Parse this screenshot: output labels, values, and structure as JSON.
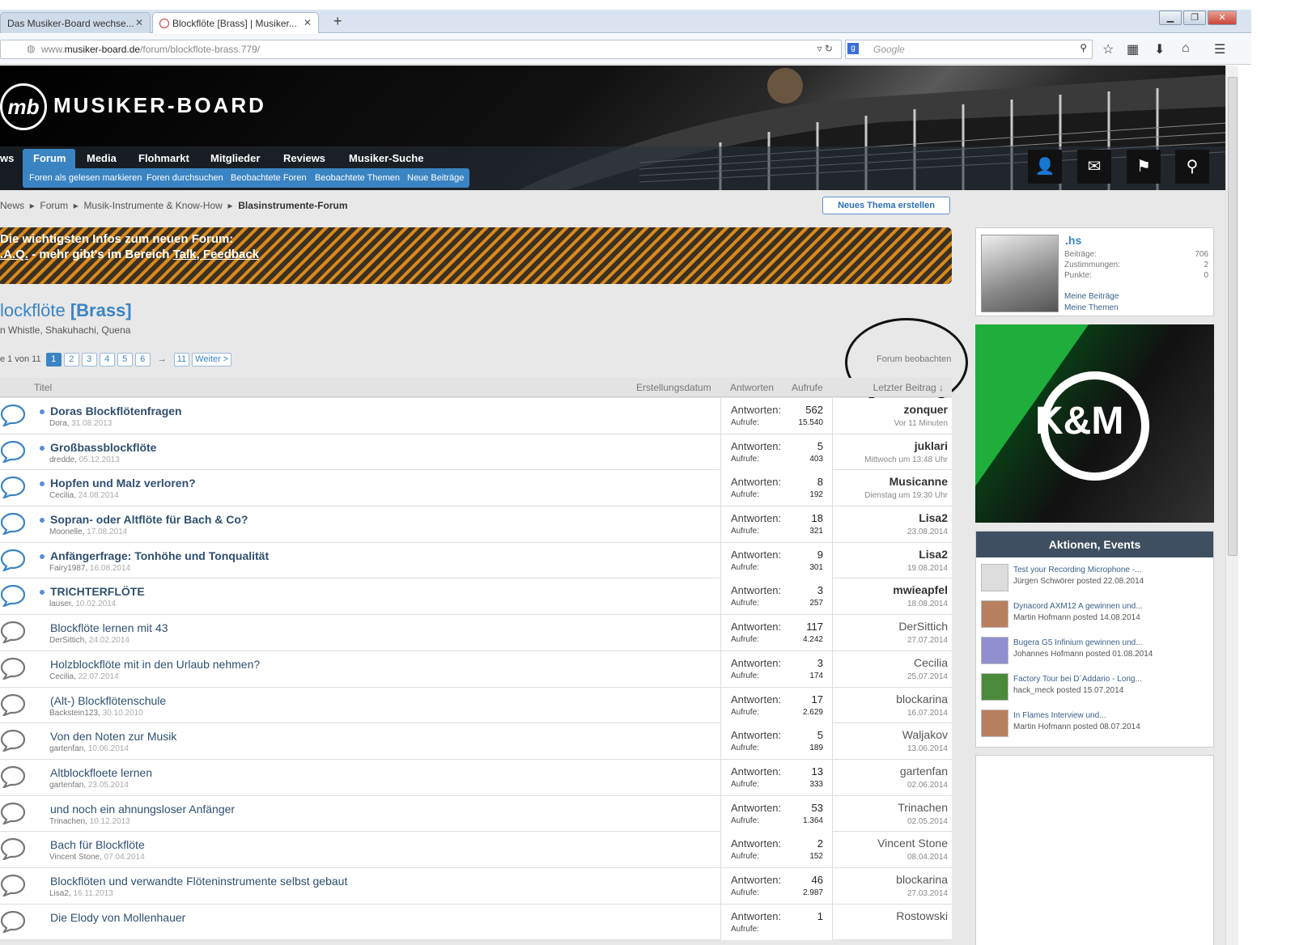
{
  "browser": {
    "tabs": [
      {
        "label": "Das Musiker-Board wechse..."
      },
      {
        "label": "Blockflöte [Brass] | Musiker..."
      }
    ],
    "new_tab": "+",
    "url_host": "www.musiker-board.de",
    "url_path": "/forum/blockflote-brass.779/",
    "search_placeholder": "Google"
  },
  "site": {
    "logo_mark": "mb",
    "logo_text": "MUSIKER-BOARD",
    "nav": [
      "ws",
      "Forum",
      "Media",
      "Flohmarkt",
      "Mitglieder",
      "Reviews",
      "Musiker-Suche"
    ],
    "subnav": [
      "Foren als gelesen markieren",
      "Foren durchsuchen",
      "Beobachtete Foren",
      "Beobachtete Themen",
      "Neue Beiträge"
    ]
  },
  "breadcrumb": {
    "items": [
      "News",
      "Forum",
      "Musik-Instrumente & Know-How"
    ],
    "current": "Blasinstrumente-Forum"
  },
  "new_thread_label": "Neues Thema erstellen",
  "notice": {
    "line1": "Die wichtigsten Infos zum neuen Forum:",
    "faq": ".A.Q.",
    "middle": " - mehr gibt's im Bereich ",
    "link": "Talk, Feedback"
  },
  "forum": {
    "title": "lockflöte ",
    "title_tag": "[Brass]",
    "description": "n Whistle, Shakuhachi, Quena",
    "page_info": "e 1 von 11",
    "pages": [
      "1",
      "2",
      "3",
      "4",
      "5",
      "6"
    ],
    "ellipsis": "→",
    "last_page": "11",
    "next": "Weiter >",
    "watch": "Forum beobachten"
  },
  "columns": {
    "title": "Titel",
    "created": "Erstellungsdatum",
    "replies": "Antworten",
    "views": "Aufrufe",
    "last": "Letzter Beitrag ↓"
  },
  "stat_labels": {
    "replies": "Antworten:",
    "views": "Aufrufe:"
  },
  "threads": [
    {
      "title": "Doras Blockflötenfragen",
      "author": "Dora,",
      "date": "31.08.2013",
      "replies": "562",
      "views": "15.540",
      "last_user": "zonquer",
      "last_date": "Vor 11 Minuten",
      "unread": true
    },
    {
      "title": "Großbassblockflöte",
      "author": "dredde,",
      "date": "05.12.2013",
      "replies": "5",
      "views": "403",
      "last_user": "juklari",
      "last_date": "Mittwoch um 13:48 Uhr",
      "unread": true
    },
    {
      "title": "Hopfen und Malz verloren?",
      "author": "Cecilia,",
      "date": "24.08.2014",
      "replies": "8",
      "views": "192",
      "last_user": "Musicanne",
      "last_date": "Dienstag um 19:30 Uhr",
      "unread": true
    },
    {
      "title": "Sopran- oder Altflöte für Bach & Co?",
      "author": "Moonelle,",
      "date": "17.08.2014",
      "replies": "18",
      "views": "321",
      "last_user": "Lisa2",
      "last_date": "23.08.2014",
      "unread": true
    },
    {
      "title": "Anfängerfrage: Tonhöhe und Tonqualität",
      "author": "Fairy1987,",
      "date": "16.08.2014",
      "replies": "9",
      "views": "301",
      "last_user": "Lisa2",
      "last_date": "19.08.2014",
      "unread": true
    },
    {
      "title": "TRICHTERFLÖTE",
      "author": "lauser,",
      "date": "10.02.2014",
      "replies": "3",
      "views": "257",
      "last_user": "mwieapfel",
      "last_date": "18.08.2014",
      "unread": true
    },
    {
      "title": "Blockflöte lernen mit 43",
      "author": "DerSittich,",
      "date": "24.02.2014",
      "replies": "117",
      "views": "4.242",
      "last_user": "DerSittich",
      "last_date": "27.07.2014",
      "unread": false
    },
    {
      "title": "Holzblockflöte mit in den Urlaub nehmen?",
      "author": "Cecilia,",
      "date": "22.07.2014",
      "replies": "3",
      "views": "174",
      "last_user": "Cecilia",
      "last_date": "25.07.2014",
      "unread": false
    },
    {
      "title": "(Alt-) Blockflötenschule",
      "author": "Backstein123,",
      "date": "30.10.2010",
      "replies": "17",
      "views": "2.629",
      "last_user": "blockarina",
      "last_date": "16.07.2014",
      "unread": false
    },
    {
      "title": "Von den Noten zur Musik",
      "author": "gartenfan,",
      "date": "10.06.2014",
      "replies": "5",
      "views": "189",
      "last_user": "Waljakov",
      "last_date": "13.06.2014",
      "unread": false
    },
    {
      "title": "Altblockfloete lernen",
      "author": "gartenfan,",
      "date": "23.05.2014",
      "replies": "13",
      "views": "333",
      "last_user": "gartenfan",
      "last_date": "02.06.2014",
      "unread": false
    },
    {
      "title": "und noch ein ahnungsloser Anfänger",
      "author": "Trinachen,",
      "date": "10.12.2013",
      "replies": "53",
      "views": "1.364",
      "last_user": "Trinachen",
      "last_date": "02.05.2014",
      "unread": false
    },
    {
      "title": "Bach für Blockflöte",
      "author": "Vincent Stone,",
      "date": "07.04.2014",
      "replies": "2",
      "views": "152",
      "last_user": "Vincent Stone",
      "last_date": "08.04.2014",
      "unread": false
    },
    {
      "title": "Blockflöten und verwandte Flöteninstrumente selbst gebaut",
      "author": "Lisa2,",
      "date": "16.11.2013",
      "replies": "46",
      "views": "2.987",
      "last_user": "blockarina",
      "last_date": "27.03.2014",
      "unread": false
    },
    {
      "title": "Die Elody von Mollenhauer",
      "author": "",
      "date": "",
      "replies": "1",
      "views": "",
      "last_user": "Rostowski",
      "last_date": "",
      "unread": false
    }
  ],
  "user": {
    "name": ".hs",
    "stats": [
      {
        "label": "Beiträge:",
        "value": "706"
      },
      {
        "label": "Zustimmungen:",
        "value": "2"
      },
      {
        "label": "Punkte:",
        "value": "0"
      }
    ],
    "links": [
      "Meine Beiträge",
      "Meine Themen"
    ]
  },
  "ad_text": "K&M",
  "events": {
    "title": "Aktionen, Events",
    "items": [
      {
        "title": "Test your Recording Microphone -...",
        "meta": "Jürgen Schwörer posted 22.08.2014"
      },
      {
        "title": "Dynacord AXM12 A gewinnen und...",
        "meta": "Martin Hofmann posted 14.08.2014"
      },
      {
        "title": "Bugera G5 Infinium gewinnen und...",
        "meta": "Johannes Hofmann posted 01.08.2014"
      },
      {
        "title": "Factory Tour bei D´Addario - Long...",
        "meta": "hack_meck posted 15.07.2014"
      },
      {
        "title": "In Flames Interview und...",
        "meta": "Martin Hofmann posted 08.07.2014"
      }
    ]
  }
}
